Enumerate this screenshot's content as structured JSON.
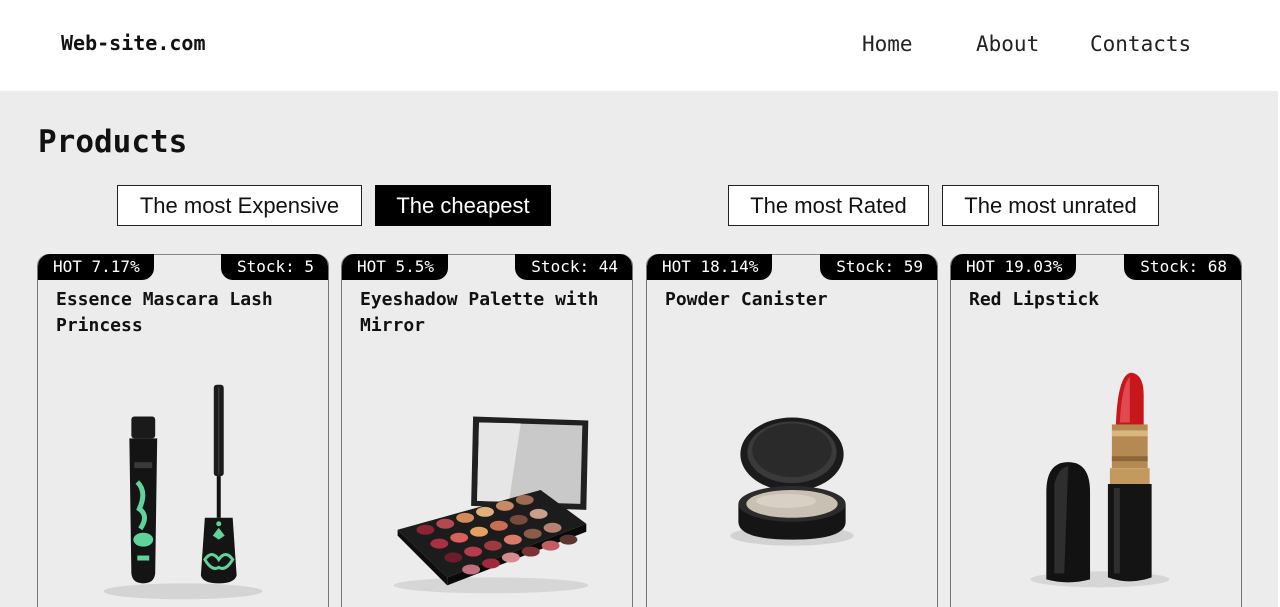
{
  "header": {
    "logo": "Web-site.com",
    "nav": [
      {
        "label": "Home"
      },
      {
        "label": "About"
      },
      {
        "label": "Contacts"
      }
    ]
  },
  "main": {
    "title": "Products",
    "filters": [
      {
        "label": "The most Expensive",
        "active": false
      },
      {
        "label": "The cheapest",
        "active": true
      },
      {
        "label": "The most Rated",
        "active": false
      },
      {
        "label": "The most unrated",
        "active": false
      }
    ],
    "products": [
      {
        "hot": "HOT 7.17%",
        "stock": "Stock: 5",
        "name": "Essence Mascara Lash Princess",
        "image": "mascara-image"
      },
      {
        "hot": "HOT 5.5%",
        "stock": "Stock: 44",
        "name": "Eyeshadow Palette with Mirror",
        "image": "eyeshadow-palette-image"
      },
      {
        "hot": "HOT 18.14%",
        "stock": "Stock: 59",
        "name": "Powder Canister",
        "image": "powder-canister-image"
      },
      {
        "hot": "HOT 19.03%",
        "stock": "Stock: 68",
        "name": "Red Lipstick",
        "image": "red-lipstick-image"
      }
    ]
  },
  "colors": {
    "page_bg": "#ececec",
    "header_bg": "#ffffff",
    "active_filter_bg": "#000000",
    "tag_bg": "#000000",
    "lipstick_red": "#c8161d",
    "mascara_green": "#5fd39a"
  }
}
